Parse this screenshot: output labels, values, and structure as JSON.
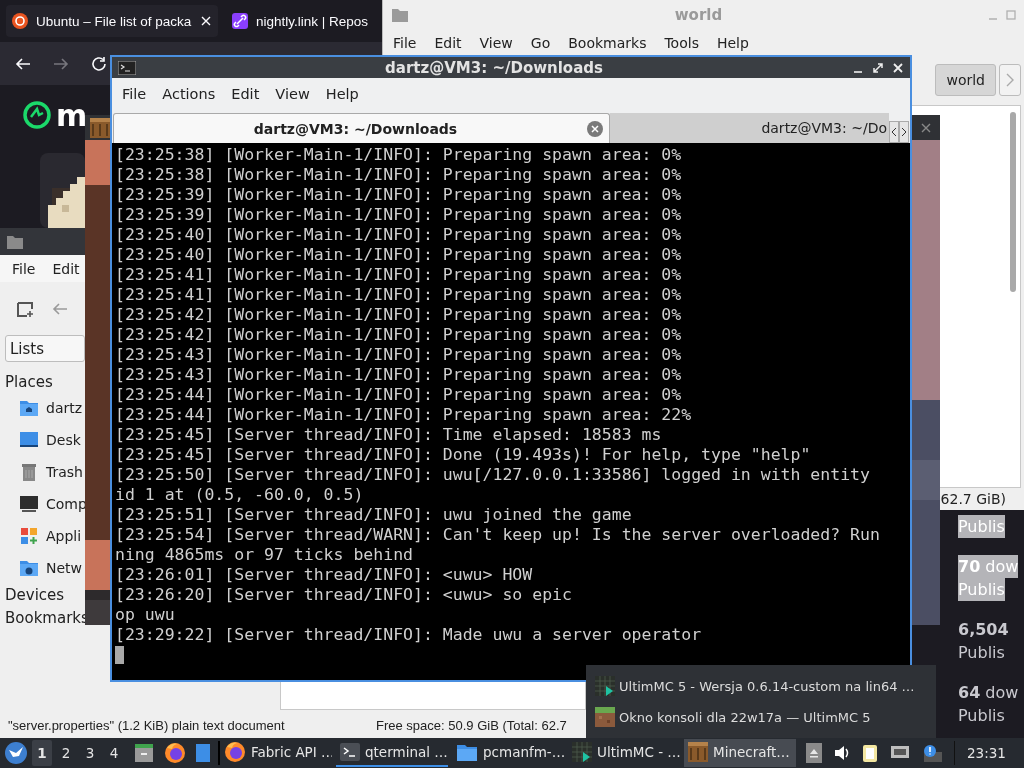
{
  "browser": {
    "tabs": [
      {
        "title": "Ubuntu – File list of packa",
        "kind": "ubuntu",
        "selected": true
      },
      {
        "title": "nightly.link | Repos",
        "kind": "link",
        "selected": false
      }
    ],
    "logo_text": "m",
    "listing": [
      {
        "text": "Publis",
        "kind": "published",
        "selected": true
      },
      {
        "text": "**70** dow",
        "kind": "count",
        "selected": true
      },
      {
        "text": "Publis",
        "kind": "published",
        "selected": true
      },
      {
        "text": "**6,504**",
        "kind": "count",
        "selected": false
      },
      {
        "text": "Publis",
        "kind": "published",
        "selected": false
      },
      {
        "text": "**64** dow",
        "kind": "count",
        "selected": false
      },
      {
        "text": "Publis",
        "kind": "published",
        "selected": false
      }
    ]
  },
  "world_window": {
    "title": "world",
    "menu": [
      "File",
      "Edit",
      "View",
      "Go",
      "Bookmarks",
      "Tools",
      "Help"
    ],
    "path": [
      "world"
    ],
    "status": "62.7 GiB)"
  },
  "file_manager": {
    "menu": [
      "File",
      "Edit"
    ],
    "view_mode": "Lists",
    "places_heading": "Places",
    "places": [
      {
        "label": "dartz",
        "kind": "home"
      },
      {
        "label": "Desk",
        "kind": "desktop"
      },
      {
        "label": "Trash",
        "kind": "trash"
      },
      {
        "label": "Comp",
        "kind": "computer"
      },
      {
        "label": "Appli",
        "kind": "apps"
      },
      {
        "label": "Netw",
        "kind": "network"
      }
    ],
    "sections": [
      "Devices",
      "Bookmarks"
    ],
    "status": {
      "selection": "\"server.properties\" (1.2 KiB) plain text document",
      "free_space": "Free space: 50.9 GiB (Total: 62.7"
    }
  },
  "terminal": {
    "title": "dartz@VM3: ~/Downloads",
    "menu": [
      "File",
      "Actions",
      "Edit",
      "View",
      "Help"
    ],
    "tabs": [
      {
        "label": "dartz@VM3: ~/Downloads",
        "selected": true
      },
      {
        "label": "dartz@VM3: ~/Do",
        "selected": false
      }
    ],
    "lines": [
      "[23:25:38] [Worker-Main-1/INFO]: Preparing spawn area: 0%",
      "[23:25:38] [Worker-Main-1/INFO]: Preparing spawn area: 0%",
      "[23:25:39] [Worker-Main-1/INFO]: Preparing spawn area: 0%",
      "[23:25:39] [Worker-Main-1/INFO]: Preparing spawn area: 0%",
      "[23:25:40] [Worker-Main-1/INFO]: Preparing spawn area: 0%",
      "[23:25:40] [Worker-Main-1/INFO]: Preparing spawn area: 0%",
      "[23:25:41] [Worker-Main-1/INFO]: Preparing spawn area: 0%",
      "[23:25:41] [Worker-Main-1/INFO]: Preparing spawn area: 0%",
      "[23:25:42] [Worker-Main-1/INFO]: Preparing spawn area: 0%",
      "[23:25:42] [Worker-Main-1/INFO]: Preparing spawn area: 0%",
      "[23:25:43] [Worker-Main-1/INFO]: Preparing spawn area: 0%",
      "[23:25:43] [Worker-Main-1/INFO]: Preparing spawn area: 0%",
      "[23:25:44] [Worker-Main-1/INFO]: Preparing spawn area: 0%",
      "[23:25:44] [Worker-Main-1/INFO]: Preparing spawn area: 22%",
      "[23:25:45] [Server thread/INFO]: Time elapsed: 18583 ms",
      "[23:25:45] [Server thread/INFO]: Done (19.493s)! For help, type \"help\"",
      "[23:25:50] [Server thread/INFO]: uwu[/127.0.0.1:33586] logged in with entity",
      "id 1 at (0.5, -60.0, 0.5)",
      "[23:25:51] [Server thread/INFO]: uwu joined the game",
      "[23:25:54] [Server thread/WARN]: Can't keep up! Is the server overloaded? Run",
      "ning 4865ms or 97 ticks behind",
      "[23:26:01] [Server thread/INFO]: <uwu> HOW",
      "[23:26:20] [Server thread/INFO]: <uwu> so epic",
      "op uwu",
      "[23:29:22] [Server thread/INFO]: Made uwu a server operator"
    ]
  },
  "popup": {
    "items": [
      {
        "label": "UltimMC 5 - Wersja 0.6.14-custom na lin64 …",
        "kind": "launcher"
      },
      {
        "label": "Okno konsoli dla 22w17a — UltimMC 5",
        "kind": "grass"
      }
    ]
  },
  "taskbar": {
    "desktops": [
      {
        "label": "1",
        "selected": true
      },
      {
        "label": "2",
        "selected": false
      },
      {
        "label": "3",
        "selected": false
      },
      {
        "label": "4",
        "selected": false
      }
    ],
    "tasks": [
      {
        "label": "Fabric API …",
        "kind": "firefox",
        "active": false,
        "highlighted": false
      },
      {
        "label": "qterminal …",
        "kind": "terminal",
        "active": true,
        "highlighted": false
      },
      {
        "label": "pcmanfm-…",
        "kind": "folder",
        "active": false,
        "highlighted": false
      },
      {
        "label": "UltimMC - …",
        "kind": "launcher",
        "active": false,
        "highlighted": false
      },
      {
        "label": "Minecraft…",
        "kind": "crate",
        "active": false,
        "highlighted": true
      }
    ],
    "clock": "23:31"
  }
}
